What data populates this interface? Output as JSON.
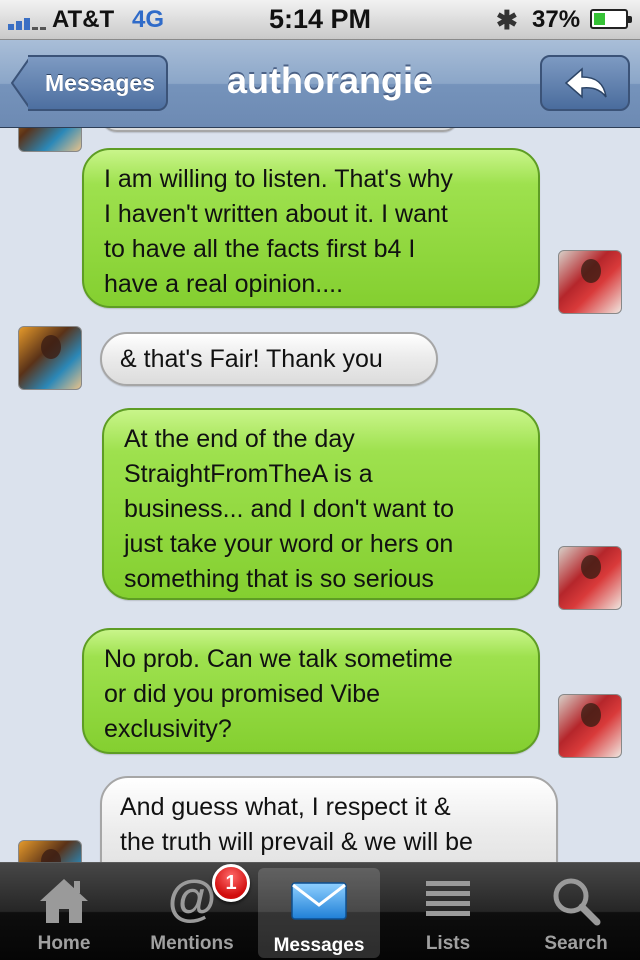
{
  "status_bar": {
    "carrier": "AT&T",
    "network": "4G",
    "time": "5:14 PM",
    "bluetooth_icon": "bluetooth-icon",
    "battery_percent": "37%",
    "battery_level": 0.37
  },
  "nav": {
    "back_label": "Messages",
    "title": "authorangie",
    "reply_icon": "reply-arrow-icon"
  },
  "messages": [
    {
      "side": "right",
      "text": "I am willing to listen. That's why\nI haven't written about it. I want\nto have all the facts first b4 I\nhave a real opinion...."
    },
    {
      "side": "left",
      "text": "& that's Fair! Thank you"
    },
    {
      "side": "right",
      "text": "At the end of the day\nStraightFromTheA is a\nbusiness... and I don't want to\njust take your word or hers on\nsomething that is so serious"
    },
    {
      "side": "right",
      "text": "No prob. Can we talk sometime\nor did you promised Vibe\nexclusivity?"
    },
    {
      "side": "left",
      "text": "And guess what, I respect it &\nthe truth will prevail & we will be"
    }
  ],
  "tab_bar": {
    "tabs": [
      {
        "label": "Home",
        "icon": "home-icon",
        "active": false
      },
      {
        "label": "Mentions",
        "icon": "at-sign-icon",
        "active": false
      },
      {
        "label": "Messages",
        "icon": "envelope-icon",
        "active": true
      },
      {
        "label": "Lists",
        "icon": "list-icon",
        "active": false
      },
      {
        "label": "Search",
        "icon": "magnifier-icon",
        "active": false
      }
    ],
    "mentions_badge": "1"
  },
  "colors": {
    "sent_bubble": "#9ee14e",
    "received_bubble": "#ececec",
    "nav_bar": "#7d9ac2",
    "badge": "#d10d0d"
  }
}
